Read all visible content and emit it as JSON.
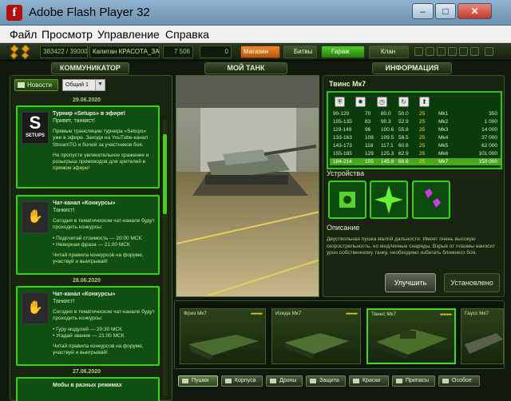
{
  "window": {
    "title": "Adobe Flash Player 32",
    "min": "–",
    "max": "□",
    "close": "✕"
  },
  "menu": [
    "Файл",
    "Просмотр",
    "Управление",
    "Справка"
  ],
  "topbar": {
    "exp": "383422 / 390000",
    "rank": "Капитан КРАСОТА_ЗАКАТ",
    "crystals": "7 506",
    "coins": "0",
    "shop": "Магазин",
    "battles": "Битвы",
    "garage": "Гараж",
    "clan": "Клан"
  },
  "headers": {
    "communicator": "КОММУНИКАТОР",
    "mytank": "МОЙ ТАНК",
    "info": "ИНФОРМАЦИЯ"
  },
  "news": {
    "tab": "Новости",
    "filter": "Общий 1",
    "dates": [
      "29.06.2020",
      "28.06.2020",
      "27.06.2020"
    ],
    "cards": [
      {
        "logo": "SETUPS",
        "title": "Турнир «Setups» в эфире!",
        "greeting": "Привет, танкист!",
        "body": [
          "Прямые трансляции турнира «Setups» уже в эфире. Заходи на YouTube-канал StreamTO и болей за участников боя.",
          "",
          "Не пропусти увлекательное сражение и розыгрыш промокодов для зрителей в прямом эфире!"
        ]
      },
      {
        "title": "Чат-канал «Конкурсы»",
        "greeting": "Танкист!",
        "body": [
          "Сегодня в тематическом чат-канале будут проходить конкурсы:",
          "",
          "• Подсчитай стоимость — 20:00 МСК",
          "• Неверная фраза — 21:00 МСК",
          "",
          "Читай правила конкурсов на форуме, участвуй и выигрывай!"
        ]
      },
      {
        "title": "Чат-канал «Конкурсы»",
        "greeting": "Танкист!",
        "body": [
          "Сегодня в тематическом чат-канале будут проходить конкурсы:",
          "",
          "• Гуру модулей — 20:30 МСК",
          "• Угадай звание — 21:00 МСК",
          "",
          "Читай правила конкурсов на форуме, участвуй и выигрывай!"
        ]
      },
      {
        "title": "Мобы в разных режимах"
      }
    ]
  },
  "info": {
    "title": "Твинс Мк7",
    "icons": [
      "protection-icon",
      "damage-icon",
      "speed-icon",
      "reload-icon",
      "upgrade-icon"
    ],
    "rows": [
      [
        "90-120",
        "70",
        "80.0",
        "50.0",
        "25",
        "Mk1",
        "350"
      ],
      [
        "105-135",
        "83",
        "90.3",
        "52.9",
        "25",
        "Mk2",
        "1 000"
      ],
      [
        "119-149",
        "96",
        "100.6",
        "55.8",
        "25",
        "Mk3",
        "14 000"
      ],
      [
        "133-163",
        "108",
        "109.5",
        "58.5",
        "25",
        "Mk4",
        "37 000"
      ],
      [
        "143-173",
        "118",
        "117.1",
        "60.6",
        "25",
        "Mk5",
        "62 000"
      ],
      [
        "155-185",
        "129",
        "125.3",
        "62.9",
        "25",
        "Mk6",
        "101 000"
      ],
      [
        "184-214",
        "155",
        "145.9",
        "68.8",
        "25",
        "Mk7",
        "150 000"
      ]
    ],
    "selected_row": 6,
    "devices_title": "Устройства",
    "desc_title": "Описание",
    "desc": "Двуствольная пушка малой дальности. Имеет очень высокую скорострельность, но медленные снаряды. Взрыв от плазмы наносит урон собственному танку, необходимо избегать ближнего боя.",
    "upgrade": "Улучшить",
    "installed": "Установлено"
  },
  "items": [
    {
      "name": "Фриз Мк7",
      "stars": "●●●●●●●"
    },
    {
      "name": "Изида Мк7",
      "stars": "●●●●●●●"
    },
    {
      "name": "Твинс Мк7",
      "stars": "●●●●●●●"
    },
    {
      "name": "Гаусс Мк7",
      "stars": ""
    }
  ],
  "categories": [
    "Пушки",
    "Корпуса",
    "Дроны",
    "Защита",
    "Краски",
    "Припасы",
    "Особое"
  ],
  "colors": {
    "accent": "#3ad11a",
    "selected": "#4ba81c",
    "orange": "#ef8a2a"
  }
}
